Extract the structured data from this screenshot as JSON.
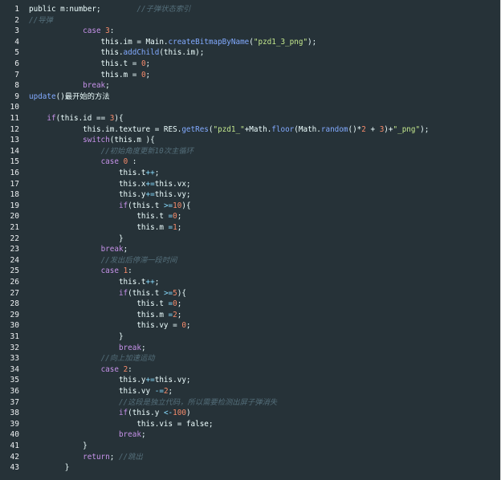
{
  "editor": {
    "line_numbers": [
      "1",
      "2",
      "3",
      "4",
      "5",
      "6",
      "7",
      "8",
      "9",
      "10",
      "11",
      "12",
      "13",
      "14",
      "15",
      "16",
      "17",
      "18",
      "19",
      "20",
      "21",
      "22",
      "23",
      "24",
      "25",
      "26",
      "27",
      "28",
      "29",
      "30",
      "31",
      "32",
      "33",
      "34",
      "35",
      "36",
      "37",
      "38",
      "39",
      "40",
      "41",
      "42",
      "43"
    ],
    "lines": [
      [
        [
          "id",
          "public m:number;        "
        ],
        [
          "cm",
          "//子弹状态索引"
        ]
      ],
      [
        [
          "cm",
          "//导弹"
        ]
      ],
      [
        [
          "id",
          "            "
        ],
        [
          "kw",
          "case"
        ],
        [
          "id",
          " "
        ],
        [
          "num",
          "3"
        ],
        [
          "id",
          ":"
        ]
      ],
      [
        [
          "id",
          "                this.im = Main."
        ],
        [
          "fn",
          "createBitmapByName"
        ],
        [
          "id",
          "("
        ],
        [
          "str",
          "\"pzd1_3_png\""
        ],
        [
          "id",
          ");"
        ]
      ],
      [
        [
          "id",
          "                this."
        ],
        [
          "fn",
          "addChild"
        ],
        [
          "id",
          "(this.im);"
        ]
      ],
      [
        [
          "id",
          "                this.t = "
        ],
        [
          "num",
          "0"
        ],
        [
          "id",
          ";"
        ]
      ],
      [
        [
          "id",
          "                this.m = "
        ],
        [
          "num",
          "0"
        ],
        [
          "id",
          ";"
        ]
      ],
      [
        [
          "id",
          "            "
        ],
        [
          "kw",
          "break"
        ],
        [
          "id",
          ";"
        ]
      ],
      [
        [
          "fn",
          "update"
        ],
        [
          "id",
          "()最开始的方法"
        ]
      ],
      [
        [
          "id",
          ""
        ]
      ],
      [
        [
          "id",
          "    "
        ],
        [
          "kw",
          "if"
        ],
        [
          "id",
          "(this.id == "
        ],
        [
          "num",
          "3"
        ],
        [
          "id",
          "){"
        ]
      ],
      [
        [
          "id",
          "            this.im.texture = RES."
        ],
        [
          "fn",
          "getRes"
        ],
        [
          "id",
          "("
        ],
        [
          "str",
          "\"pzd1_\""
        ],
        [
          "id",
          "+Math."
        ],
        [
          "fn",
          "floor"
        ],
        [
          "id",
          "(Math."
        ],
        [
          "fn",
          "random"
        ],
        [
          "id",
          "()*"
        ],
        [
          "num",
          "2"
        ],
        [
          "id",
          " + "
        ],
        [
          "num",
          "3"
        ],
        [
          "id",
          ")+"
        ],
        [
          "str",
          "\"_png\""
        ],
        [
          "id",
          ");"
        ]
      ],
      [
        [
          "id",
          "            "
        ],
        [
          "kw",
          "switch"
        ],
        [
          "id",
          "(this.m ){"
        ]
      ],
      [
        [
          "id",
          "                "
        ],
        [
          "cm",
          "//初始角度更新10次主循环"
        ]
      ],
      [
        [
          "id",
          "                "
        ],
        [
          "kw",
          "case"
        ],
        [
          "id",
          " "
        ],
        [
          "num",
          "0"
        ],
        [
          "id",
          " :"
        ]
      ],
      [
        [
          "id",
          "                    this.t"
        ],
        [
          "op",
          "++"
        ],
        [
          "id",
          ";"
        ]
      ],
      [
        [
          "id",
          "                    this.x"
        ],
        [
          "op",
          "+="
        ],
        [
          "id",
          "this.vx;"
        ]
      ],
      [
        [
          "id",
          "                    this.y"
        ],
        [
          "op",
          "+="
        ],
        [
          "id",
          "this.vy;"
        ]
      ],
      [
        [
          "id",
          "                    "
        ],
        [
          "kw",
          "if"
        ],
        [
          "id",
          "(this.t "
        ],
        [
          "op",
          ">="
        ],
        [
          "num",
          "10"
        ],
        [
          "id",
          "){"
        ]
      ],
      [
        [
          "id",
          "                        this.t "
        ],
        [
          "op",
          "="
        ],
        [
          "num",
          "0"
        ],
        [
          "id",
          ";"
        ]
      ],
      [
        [
          "id",
          "                        this.m "
        ],
        [
          "op",
          "="
        ],
        [
          "num",
          "1"
        ],
        [
          "id",
          ";"
        ]
      ],
      [
        [
          "id",
          "                    }"
        ]
      ],
      [
        [
          "id",
          "                "
        ],
        [
          "kw",
          "break"
        ],
        [
          "id",
          ";"
        ]
      ],
      [
        [
          "id",
          "                "
        ],
        [
          "cm",
          "//发出后停滞一段时间"
        ]
      ],
      [
        [
          "id",
          "                "
        ],
        [
          "kw",
          "case"
        ],
        [
          "id",
          " "
        ],
        [
          "num",
          "1"
        ],
        [
          "id",
          ":"
        ]
      ],
      [
        [
          "id",
          "                    this.t"
        ],
        [
          "op",
          "++"
        ],
        [
          "id",
          ";"
        ]
      ],
      [
        [
          "id",
          "                    "
        ],
        [
          "kw",
          "if"
        ],
        [
          "id",
          "(this.t "
        ],
        [
          "op",
          ">="
        ],
        [
          "num",
          "5"
        ],
        [
          "id",
          "){"
        ]
      ],
      [
        [
          "id",
          "                        this.t "
        ],
        [
          "op",
          "="
        ],
        [
          "num",
          "0"
        ],
        [
          "id",
          ";"
        ]
      ],
      [
        [
          "id",
          "                        this.m "
        ],
        [
          "op",
          "="
        ],
        [
          "num",
          "2"
        ],
        [
          "id",
          ";"
        ]
      ],
      [
        [
          "id",
          "                        this.vy = "
        ],
        [
          "num",
          "0"
        ],
        [
          "id",
          ";"
        ]
      ],
      [
        [
          "id",
          "                    }"
        ]
      ],
      [
        [
          "id",
          "                    "
        ],
        [
          "kw",
          "break"
        ],
        [
          "id",
          ";"
        ]
      ],
      [
        [
          "id",
          "                "
        ],
        [
          "cm",
          "//向上加速运动"
        ]
      ],
      [
        [
          "id",
          "                "
        ],
        [
          "kw",
          "case"
        ],
        [
          "id",
          " "
        ],
        [
          "num",
          "2"
        ],
        [
          "id",
          ":"
        ]
      ],
      [
        [
          "id",
          "                    this.y"
        ],
        [
          "op",
          "+="
        ],
        [
          "id",
          "this.vy;"
        ]
      ],
      [
        [
          "id",
          "                    this.vy "
        ],
        [
          "op",
          "-="
        ],
        [
          "num",
          "2"
        ],
        [
          "id",
          ";"
        ]
      ],
      [
        [
          "id",
          "                    "
        ],
        [
          "cm",
          "//这段是独立代码，所以需要检测出屏子弹消失"
        ]
      ],
      [
        [
          "id",
          "                    "
        ],
        [
          "kw",
          "if"
        ],
        [
          "id",
          "(this.y "
        ],
        [
          "op",
          "<-"
        ],
        [
          "num",
          "100"
        ],
        [
          "id",
          ")"
        ]
      ],
      [
        [
          "id",
          "                        this.vis = false;"
        ]
      ],
      [
        [
          "id",
          "                    "
        ],
        [
          "kw",
          "break"
        ],
        [
          "id",
          ";"
        ]
      ],
      [
        [
          "id",
          "            }"
        ]
      ],
      [
        [
          "id",
          "            "
        ],
        [
          "kw",
          "return"
        ],
        [
          "id",
          "; "
        ],
        [
          "cm",
          "//跳出"
        ]
      ],
      [
        [
          "id",
          "        }"
        ]
      ]
    ]
  },
  "colors": {
    "background": "#263238",
    "keyword": "#c792ea",
    "function": "#82aaff",
    "string": "#c3e88d",
    "number": "#f78c6c",
    "operator": "#89ddff",
    "comment": "#546e7a",
    "text": "#eeffff"
  }
}
